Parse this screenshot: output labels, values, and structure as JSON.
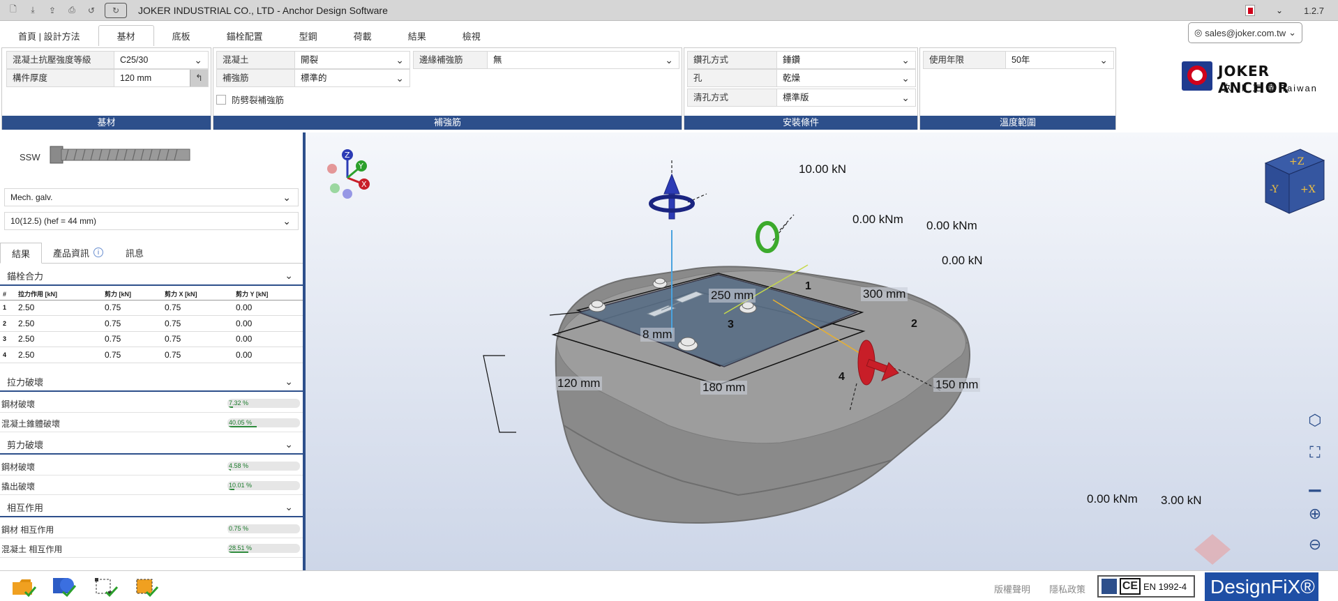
{
  "titlebar": {
    "title": "JOKER INDUSTRIAL CO., LTD - Anchor Design Software",
    "version": "1.2.7",
    "icons": [
      "new-file-icon",
      "save-icon",
      "export-icon",
      "print-icon",
      "undo-icon",
      "redo-icon"
    ]
  },
  "tabs": [
    "首頁 | 設計方法",
    "基材",
    "底板",
    "錨栓配置",
    "型鋼",
    "荷載",
    "結果",
    "檢視"
  ],
  "active_tab": "基材",
  "user": {
    "email": "sales@joker.com.tw"
  },
  "ribbon": {
    "base": {
      "footer": "基材",
      "concrete_grade_label": "混凝土抗壓強度等級",
      "concrete_grade_value": "C25/30",
      "thickness_label": "構件厚度",
      "thickness_value": "120 mm"
    },
    "reinforcement": {
      "footer": "補強筋",
      "concrete_label": "混凝土",
      "concrete_value": "開裂",
      "rebar_label": "補強筋",
      "rebar_value": "標準的",
      "edge_label": "邊緣補強筋",
      "edge_value": "無",
      "crack_check_label": "防劈裂補強筋"
    },
    "install": {
      "footer": "安裝條件",
      "drill_label": "鑽孔方式",
      "drill_value": "錘鑽",
      "hole_label": "孔",
      "hole_value": "乾燥",
      "clean_label": "清孔方式",
      "clean_value": "標準版"
    },
    "temperature": {
      "footer": "溫度範圍",
      "life_label": "使用年限",
      "life_value": "50年"
    }
  },
  "logo": {
    "name": "JOKER ANCHOR",
    "sub": "久 川 工 業  Taiwan"
  },
  "left": {
    "product": "SSW",
    "coating": "Mech. galv.",
    "size": "10(12.5) (hef = 44 mm)",
    "subtabs": [
      "結果",
      "產品資訊",
      "訊息"
    ],
    "forces_title": "錨栓合力",
    "table_headers": [
      "#",
      "拉力作用 [kN]",
      "剪力 [kN]",
      "剪力 X [kN]",
      "剪力 Y [kN]"
    ],
    "table_rows": [
      [
        "1",
        "2.50",
        "0.75",
        "0.75",
        "0.00"
      ],
      [
        "2",
        "2.50",
        "0.75",
        "0.75",
        "0.00"
      ],
      [
        "3",
        "2.50",
        "0.75",
        "0.75",
        "0.00"
      ],
      [
        "4",
        "2.50",
        "0.75",
        "0.75",
        "0.00"
      ]
    ],
    "tension_title": "拉力破壞",
    "tension_items": [
      {
        "label": "鋼材破壞",
        "value": "7.32 %",
        "pct": 7.32
      },
      {
        "label": "混凝土錐體破壞",
        "value": "40.05 %",
        "pct": 40.05
      }
    ],
    "shear_title": "剪力破壞",
    "shear_items": [
      {
        "label": "鋼材破壞",
        "value": "4.58 %",
        "pct": 4.58
      },
      {
        "label": "撬出破壞",
        "value": "10.01 %",
        "pct": 10.01
      }
    ],
    "interaction_title": "相互作用",
    "interaction_items": [
      {
        "label": "鋼材 相互作用",
        "value": "0.75 %",
        "pct": 0.75
      },
      {
        "label": "混凝土 相互作用",
        "value": "28.51 %",
        "pct": 28.51
      }
    ]
  },
  "viewport": {
    "axis_labels": [
      "Z",
      "Y",
      "X"
    ],
    "cube_labels": [
      "+Z",
      "-Y",
      "+X"
    ],
    "load_n": "10.00 kN",
    "moment_z": "0.00 kNm",
    "moment_y": "0.00 kNm",
    "shear_y": "0.00 kN",
    "moment_x": "0.00 kNm",
    "shear_x": "3.00 kN",
    "dim_250": "250 mm",
    "dim_300": "300 mm",
    "dim_8": "8 mm",
    "dim_120": "120 mm",
    "dim_180": "180 mm",
    "dim_150": "150 mm",
    "bolts": [
      "1",
      "2",
      "3",
      "4"
    ]
  },
  "footer": {
    "copyright": "版權聲明",
    "privacy": "隱私政策",
    "standard": "EN 1992-4",
    "brand": "DesignFiX®"
  },
  "colors": {
    "accent": "#2d4f8b",
    "progress": "#2e8b3c",
    "brand": "#1f4fa5"
  }
}
